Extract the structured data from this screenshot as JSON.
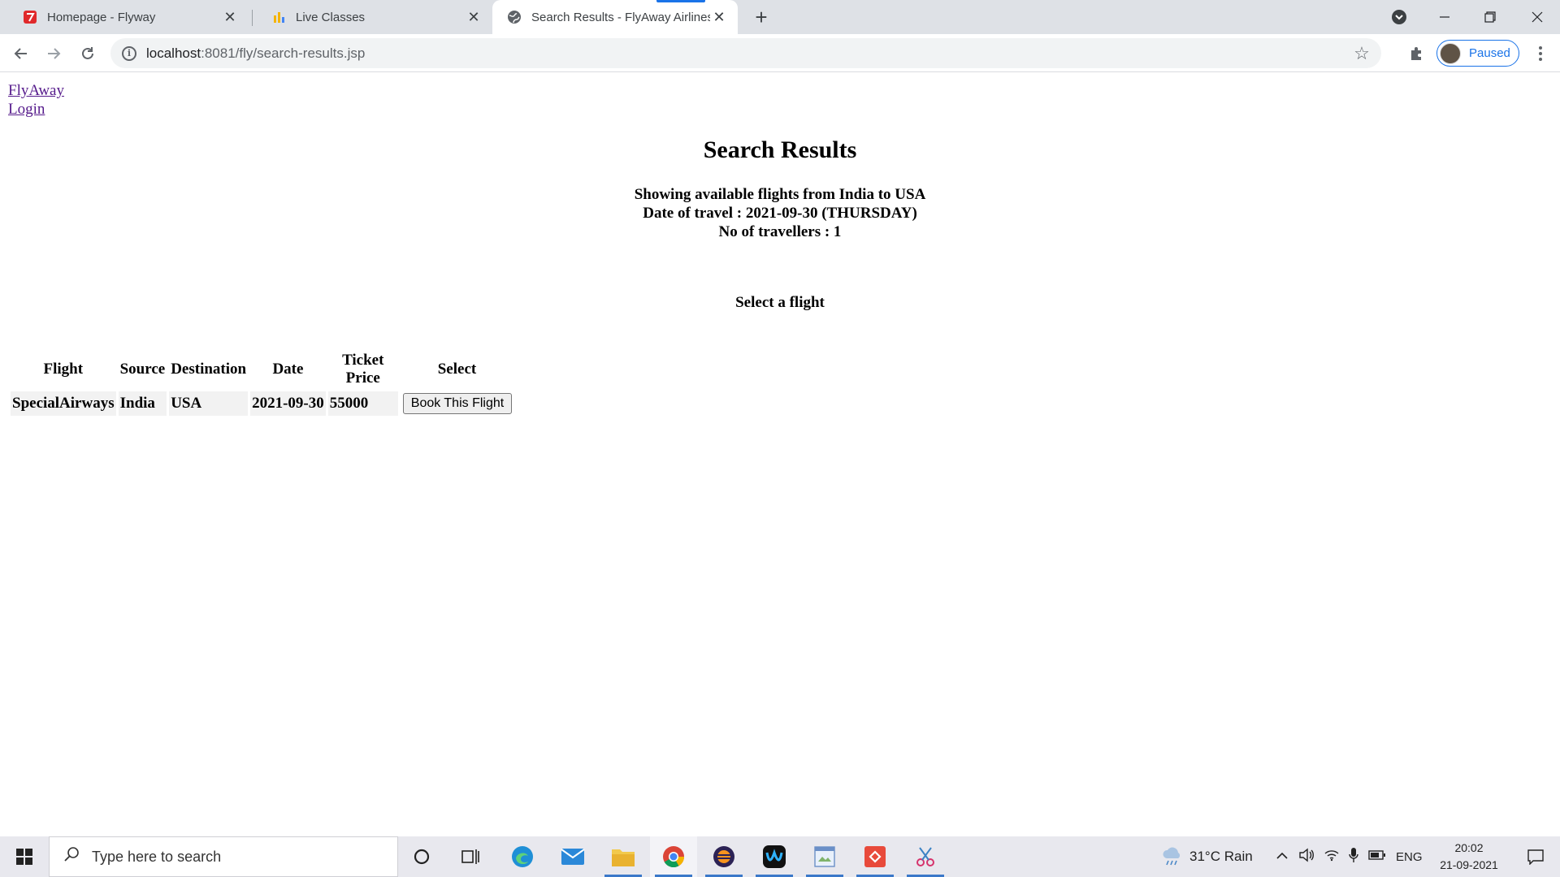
{
  "browser": {
    "tabs": [
      {
        "title": "Homepage - Flyway",
        "active": false
      },
      {
        "title": "Live Classes",
        "active": false
      },
      {
        "title": "Search Results - FlyAway Airlines",
        "active": true
      }
    ],
    "url_host": "localhost",
    "url_rest": ":8081/fly/search-results.jsp",
    "profile_label": "Paused",
    "accent_color": "#1a73e8"
  },
  "page": {
    "links": [
      "FlyAway",
      "Login"
    ],
    "title": "Search Results",
    "summary": [
      "Showing available flights from India to USA",
      "Date of travel : 2021-09-30 (THURSDAY)",
      "No of travellers : 1"
    ],
    "select_heading": "Select a flight",
    "table": {
      "headers": [
        "Flight",
        "Source",
        "Destination",
        "Date",
        "Ticket Price",
        "Select"
      ],
      "rows": [
        {
          "flight": "SpecialAirways",
          "source": "India",
          "destination": "USA",
          "date": "2021-09-30",
          "price": "55000",
          "button": "Book This Flight"
        }
      ]
    }
  },
  "taskbar": {
    "search_placeholder": "Type here to search",
    "weather": "31°C  Rain",
    "language": "ENG",
    "time": "20:02",
    "date": "21-09-2021"
  }
}
